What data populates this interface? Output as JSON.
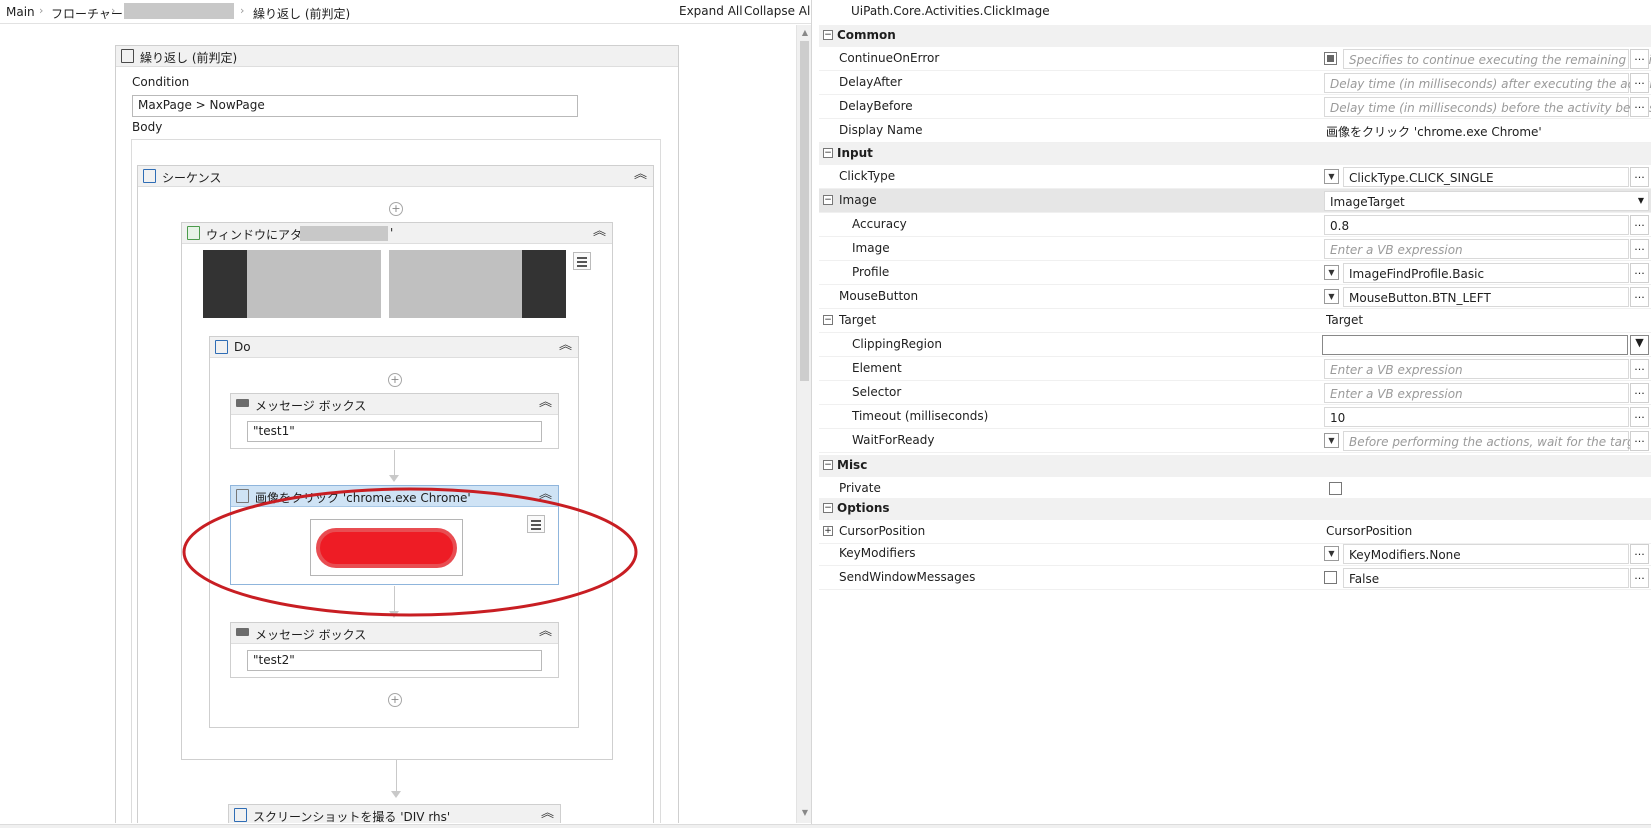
{
  "breadcrumb": {
    "items": [
      "Main",
      "フローチャート",
      "繰り返し (前判定)"
    ],
    "expand_all": "Expand All",
    "collapse_all": "Collapse All"
  },
  "designer": {
    "while_title": "繰り返し (前判定)",
    "condition_label": "Condition",
    "condition_value": "MaxPage > NowPage",
    "body_label": "Body",
    "sequence_title": "シーケンス",
    "attach_title": "ウィンドウにアタッチ '",
    "attach_title_end": "'",
    "do_title": "Do",
    "msg1_title": "メッセージ ボックス",
    "msg1_value": "\"test1\"",
    "click_title": "画像をクリック 'chrome.exe Chrome'",
    "msg2_title": "メッセージ ボックス",
    "msg2_value": "\"test2\"",
    "screenshot_title": "スクリーンショットを撮る 'DIV  rhs'",
    "plus": "+",
    "collapse_glyph": "︽"
  },
  "properties": {
    "title": "UiPath.Core.Activities.ClickImage",
    "ellipsis": "...",
    "categories": {
      "common": "Common",
      "input": "Input",
      "misc": "Misc",
      "options": "Options"
    },
    "continue_on_error": {
      "name": "ContinueOnError",
      "value": "Specifies to continue executing the remaining activi"
    },
    "delay_after": {
      "name": "DelayAfter",
      "value": "Delay time (in milliseconds) after executing the activity."
    },
    "delay_before": {
      "name": "DelayBefore",
      "value": "Delay time (in milliseconds) before the activity begins p"
    },
    "display_name": {
      "name": "Display Name",
      "value": "画像をクリック 'chrome.exe Chrome'"
    },
    "click_type": {
      "name": "ClickType",
      "value": "ClickType.CLICK_SINGLE"
    },
    "image": {
      "name": "Image",
      "value": "ImageTarget"
    },
    "accuracy": {
      "name": "Accuracy",
      "value": "0.8"
    },
    "image_sub": {
      "name": "Image",
      "value": "Enter a VB expression"
    },
    "profile": {
      "name": "Profile",
      "value": "ImageFindProfile.Basic"
    },
    "mouse_button": {
      "name": "MouseButton",
      "value": "MouseButton.BTN_LEFT"
    },
    "target": {
      "name": "Target",
      "value": "Target"
    },
    "clipping_region": {
      "name": "ClippingRegion",
      "value": ""
    },
    "element": {
      "name": "Element",
      "value": "Enter a VB expression"
    },
    "selector": {
      "name": "Selector",
      "value": "Enter a VB expression"
    },
    "timeout": {
      "name": "Timeout (milliseconds)",
      "value": "10"
    },
    "wait_for_ready": {
      "name": "WaitForReady",
      "value": "Before performing the actions, wait for the target tc"
    },
    "private": {
      "name": "Private"
    },
    "cursor_position": {
      "name": "CursorPosition",
      "value": "CursorPosition"
    },
    "key_modifiers": {
      "name": "KeyModifiers",
      "value": "KeyModifiers.None"
    },
    "send_window_messages": {
      "name": "SendWindowMessages",
      "value": "False"
    }
  },
  "colors": {
    "highlight_ellipse": "#c81e23",
    "selected_header": "#cfe3f5",
    "image_button_red": "#ee1c25"
  }
}
